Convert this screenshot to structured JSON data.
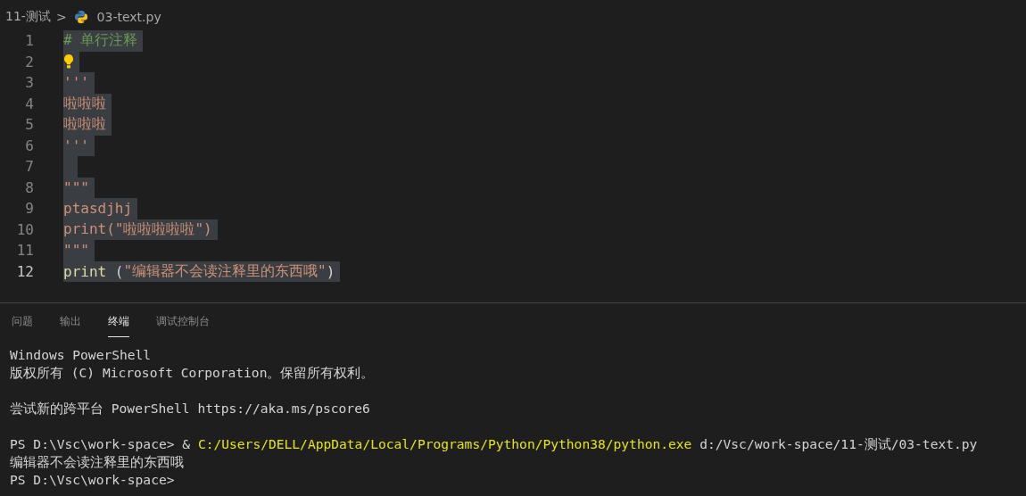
{
  "breadcrumb": {
    "folder": "11-测试",
    "separator": ">",
    "file": "03-text.py"
  },
  "editor": {
    "lines": [
      {
        "number": "1",
        "current": false,
        "selected": true,
        "segments": [
          {
            "kind": "comment",
            "text": "# 单行注释"
          }
        ]
      },
      {
        "number": "2",
        "current": false,
        "selected": true,
        "lightbulb": true
      },
      {
        "number": "3",
        "current": false,
        "selected": true,
        "segments": [
          {
            "kind": "string",
            "text": "'''"
          }
        ]
      },
      {
        "number": "4",
        "current": false,
        "selected": true,
        "segments": [
          {
            "kind": "string",
            "text": "啦啦啦"
          }
        ]
      },
      {
        "number": "5",
        "current": false,
        "selected": true,
        "segments": [
          {
            "kind": "string",
            "text": "啦啦啦"
          }
        ]
      },
      {
        "number": "6",
        "current": false,
        "selected": true,
        "segments": [
          {
            "kind": "string",
            "text": "'''"
          }
        ]
      },
      {
        "number": "7",
        "current": false,
        "selected": true
      },
      {
        "number": "8",
        "current": false,
        "selected": true,
        "segments": [
          {
            "kind": "string",
            "text": "\"\"\""
          }
        ]
      },
      {
        "number": "9",
        "current": false,
        "selected": true,
        "segments": [
          {
            "kind": "string",
            "text": "ptasdjhj"
          }
        ]
      },
      {
        "number": "10",
        "current": false,
        "selected": true,
        "segments": [
          {
            "kind": "string",
            "text": "print(\"啦啦啦啦啦\")"
          }
        ]
      },
      {
        "number": "11",
        "current": false,
        "selected": true,
        "segments": [
          {
            "kind": "string",
            "text": "\"\"\""
          }
        ]
      },
      {
        "number": "12",
        "current": true,
        "selected": true,
        "segments": [
          {
            "kind": "function",
            "text": "print"
          },
          {
            "kind": "plain",
            "text": " ("
          },
          {
            "kind": "string",
            "text": "\"编辑器不会读注释里的东西哦\""
          },
          {
            "kind": "plain",
            "text": ")"
          }
        ]
      }
    ]
  },
  "panel": {
    "tabs": [
      {
        "label": "问题",
        "selected": false
      },
      {
        "label": "输出",
        "selected": false
      },
      {
        "label": "终端",
        "selected": true
      },
      {
        "label": "调试控制台",
        "selected": false
      }
    ],
    "terminal": [
      {
        "kind": "text",
        "segments": [
          {
            "kind": "plain",
            "text": "Windows PowerShell"
          }
        ]
      },
      {
        "kind": "text",
        "segments": [
          {
            "kind": "plain",
            "text": "版权所有 (C) Microsoft Corporation。保留所有权利。"
          }
        ]
      },
      {
        "kind": "blank"
      },
      {
        "kind": "text",
        "segments": [
          {
            "kind": "plain",
            "text": "尝试新的跨平台 PowerShell https://aka.ms/pscore6"
          }
        ]
      },
      {
        "kind": "blank"
      },
      {
        "kind": "text",
        "segments": [
          {
            "kind": "plain",
            "text": "PS D:\\Vsc\\work-space> & "
          },
          {
            "kind": "path",
            "text": "C:/Users/DELL/AppData/Local/Programs/Python/Python38/python.exe"
          },
          {
            "kind": "plain",
            "text": " d:/Vsc/work-space/11-测试/03-text.py"
          }
        ]
      },
      {
        "kind": "text",
        "segments": [
          {
            "kind": "plain",
            "text": "编辑器不会读注释里的东西哦"
          }
        ]
      },
      {
        "kind": "text",
        "segments": [
          {
            "kind": "plain",
            "text": "PS D:\\Vsc\\work-space>"
          }
        ]
      }
    ]
  }
}
